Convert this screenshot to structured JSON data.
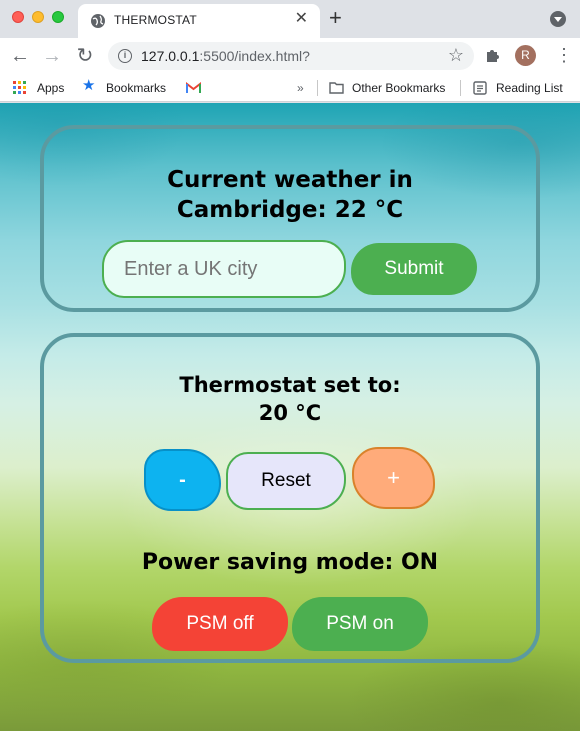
{
  "browser": {
    "tab_title": "THERMOSTAT",
    "url_host": "127.0.0.1",
    "url_rest": ":5500/index.html?",
    "avatar_letter": "R",
    "bookmarks": {
      "apps": "Apps",
      "bookmarks": "Bookmarks",
      "overflow": "»",
      "other": "Other Bookmarks",
      "reading_list": "Reading List"
    }
  },
  "weather": {
    "heading_line1": "Current weather in",
    "heading_line2": "Cambridge: 22 °C",
    "city_placeholder": "Enter a UK city",
    "submit_label": "Submit"
  },
  "thermostat": {
    "heading_line1": "Thermostat set to:",
    "heading_line2": "20 °C",
    "down_label": "-",
    "reset_label": "Reset",
    "up_label": "+",
    "psm_status": "Power saving mode: ON",
    "psm_off_label": "PSM off",
    "psm_on_label": "PSM on"
  },
  "colors": {
    "card_border": "#5b9aa0",
    "green": "#4caf50",
    "red": "#f44336",
    "blue": "#0db3f0",
    "orange": "#ffab7a",
    "lavender": "#e6e6fa"
  },
  "icons": [
    "globe-icon",
    "close-icon",
    "plus-icon",
    "back-icon",
    "forward-icon",
    "reload-icon",
    "info-icon",
    "star-icon",
    "puzzle-icon",
    "apps-grid-icon",
    "bookmark-star-icon",
    "gmail-icon",
    "folder-icon",
    "reading-list-icon"
  ]
}
